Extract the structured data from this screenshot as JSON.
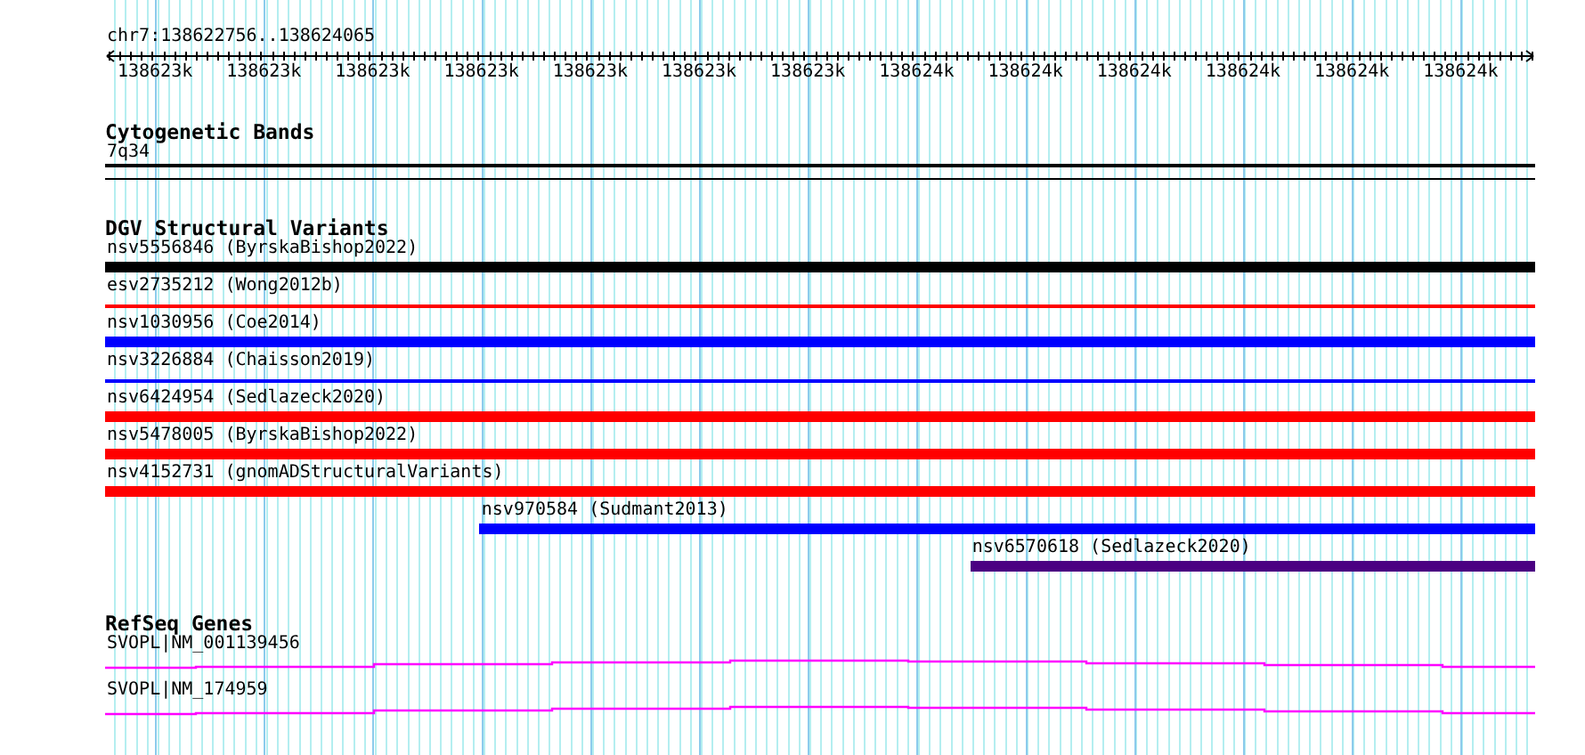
{
  "locus": "chr7:138622756..138624065",
  "ruler": {
    "tick_labels": [
      "138623k",
      "138623k",
      "138623k",
      "138623k",
      "138623k",
      "138623k",
      "138623k",
      "138624k",
      "138624k",
      "138624k",
      "138624k",
      "138624k",
      "138624k"
    ]
  },
  "tracks": [
    {
      "kind": "bands",
      "title": "Cytogenetic Bands",
      "features": [
        {
          "label": "7q34"
        }
      ]
    },
    {
      "kind": "variants",
      "title": "DGV Structural Variants",
      "features": [
        {
          "label": "nsv5556846 (ByrskaBishop2022)",
          "kind": "thick",
          "color": "#000000",
          "level": 1
        },
        {
          "label": "esv2735212 (Wong2012b)",
          "kind": "thin",
          "color": "#ff0000",
          "level": 1
        },
        {
          "label": "nsv1030956 (Coe2014)",
          "kind": "thick",
          "color": "#0000ff",
          "level": 1
        },
        {
          "label": "nsv3226884 (Chaisson2019)",
          "kind": "thin",
          "color": "#0000ff",
          "level": 1
        },
        {
          "label": "nsv6424954 (Sedlazeck2020)",
          "kind": "thick",
          "color": "#ff0000",
          "level": 1
        },
        {
          "label": "nsv5478005 (ByrskaBishop2022)",
          "kind": "thick",
          "color": "#ff0000",
          "level": 1
        },
        {
          "label": "nsv4152731 (gnomADStructuralVariants)",
          "kind": "thick",
          "color": "#ff0000",
          "level": 1
        },
        {
          "label": "nsv970584 (Sudmant2013)",
          "kind": "thick",
          "color": "#0000ff",
          "level": 0.738
        },
        {
          "label": "nsv6570618 (Sedlazeck2020)",
          "kind": "thick",
          "color": "#4b0082",
          "level": 0.395
        }
      ]
    },
    {
      "kind": "genes",
      "title": "RefSeq Genes",
      "features": [
        {
          "label": "SVOPL|NM_001139456"
        },
        {
          "label": "SVOPL|NM_174959"
        }
      ]
    }
  ]
}
